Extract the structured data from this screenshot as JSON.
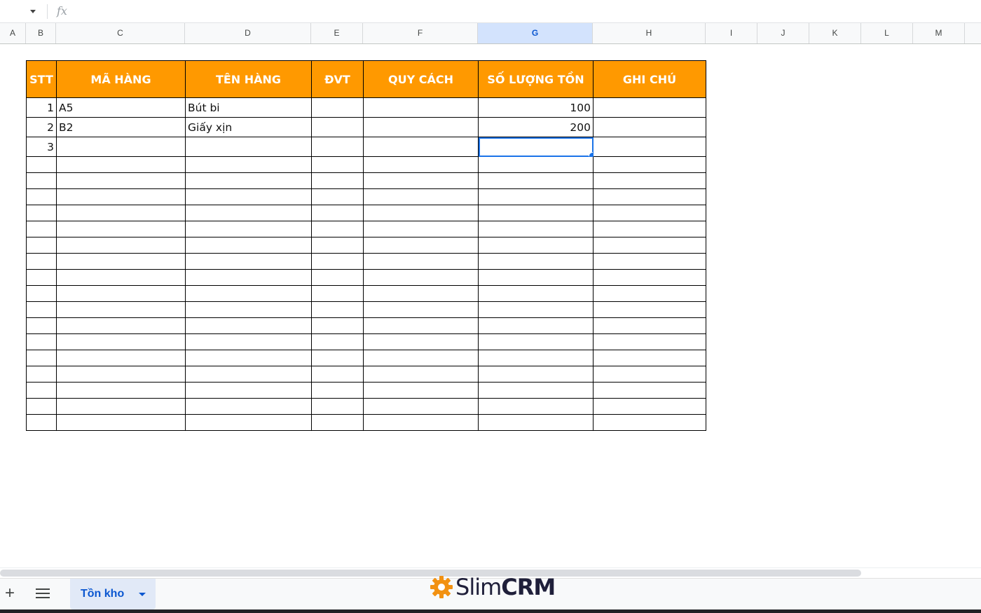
{
  "formula_bar": {
    "fx_label": "fx",
    "content": ""
  },
  "columns": [
    "A",
    "B",
    "C",
    "D",
    "E",
    "F",
    "G",
    "H",
    "I",
    "J",
    "K",
    "L",
    "M"
  ],
  "selected_column": "G",
  "table": {
    "headers": [
      "STT",
      "MÃ HÀNG",
      "TÊN HÀNG",
      "ĐVT",
      "QUY CÁCH",
      "SỐ LƯỢNG TỒN",
      "GHI CHÚ"
    ],
    "rows": [
      [
        "1",
        "A5",
        "Bút bi",
        "",
        "",
        "100",
        ""
      ],
      [
        "2",
        "B2",
        "Giấy xịn",
        "",
        "",
        "200",
        ""
      ],
      [
        "3",
        "",
        "",
        "",
        "",
        "",
        ""
      ]
    ],
    "blank_rows": 17
  },
  "selected_cell": {
    "row": 3,
    "column": "SỐ LƯỢNG TỒN"
  },
  "sheet_tabs": [
    {
      "label": "Tồn kho",
      "active": true
    }
  ],
  "logo": {
    "part1": "Slim",
    "part2": "CRM"
  },
  "colors": {
    "header_fill": "#ff9900",
    "accent": "#1a73e8",
    "logo_gear": "#f29111"
  }
}
